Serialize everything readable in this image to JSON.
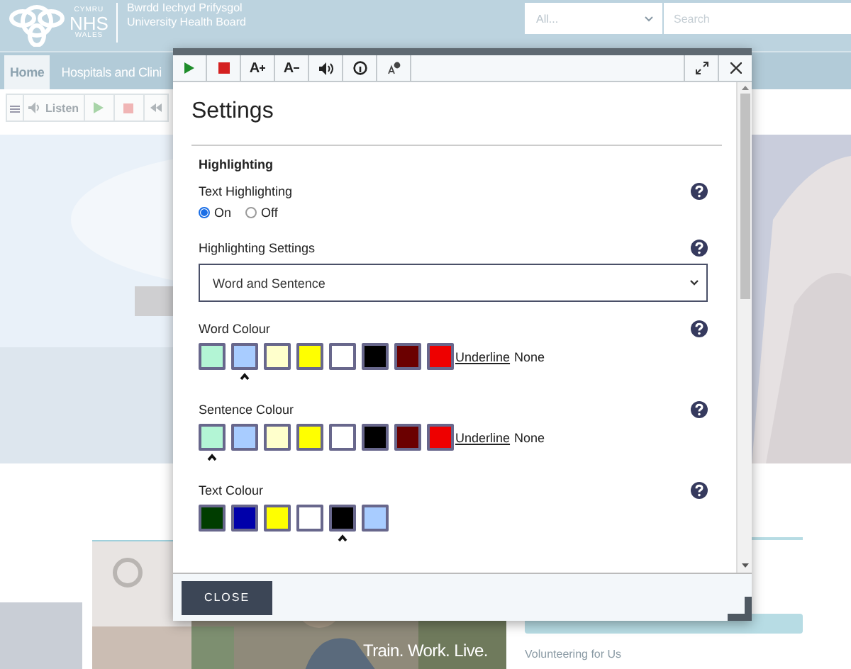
{
  "header": {
    "logo_lines": [
      "CYMRU",
      "NHS",
      "WALES"
    ],
    "org_lines": [
      "Bwrdd Iechyd Prifysgol",
      "University Health Board"
    ],
    "scope_select": {
      "value": "All..."
    },
    "search": {
      "placeholder": "Search"
    }
  },
  "nav": [
    {
      "label": "Home",
      "selected": true
    },
    {
      "label": "Hospitals and Clini",
      "selected": false
    }
  ],
  "listen_bar": {
    "label": "Listen"
  },
  "promo": {
    "caption": "Train. Work. Live."
  },
  "sidebar_link": "Volunteering for Us",
  "dialog": {
    "toolbar": [
      {
        "kind": "play"
      },
      {
        "kind": "stop"
      },
      {
        "kind": "font-larger",
        "glyph": "A"
      },
      {
        "kind": "font-smaller",
        "glyph": "A"
      },
      {
        "kind": "volume"
      },
      {
        "kind": "info"
      },
      {
        "kind": "settings"
      }
    ],
    "title": "Settings",
    "heading": "Highlighting",
    "text_highlighting": {
      "label": "Text Highlighting",
      "options": [
        {
          "label": "On",
          "selected": true
        },
        {
          "label": "Off",
          "selected": false
        }
      ]
    },
    "highlighting_settings": {
      "label": "Highlighting Settings",
      "value": "Word and Sentence"
    },
    "palettes": [
      {
        "label": "Word Colour",
        "underline_link": "Underline",
        "underline_value": "None",
        "swatches": [
          {
            "color": "#b3f5d5",
            "selected": false
          },
          {
            "color": "#a8ccff",
            "selected": true
          },
          {
            "color": "#ffffcc",
            "selected": false
          },
          {
            "color": "#ffff00",
            "selected": false
          },
          {
            "color": "#ffffff",
            "selected": false
          },
          {
            "color": "#000000",
            "selected": false
          },
          {
            "color": "#6b0000",
            "selected": false
          },
          {
            "color": "#ee0000",
            "selected": false
          }
        ]
      },
      {
        "label": "Sentence Colour",
        "underline_link": "Underline",
        "underline_value": "None",
        "swatches": [
          {
            "color": "#b3f5d5",
            "selected": true
          },
          {
            "color": "#a8ccff",
            "selected": false
          },
          {
            "color": "#ffffcc",
            "selected": false
          },
          {
            "color": "#ffff00",
            "selected": false
          },
          {
            "color": "#ffffff",
            "selected": false
          },
          {
            "color": "#000000",
            "selected": false
          },
          {
            "color": "#6b0000",
            "selected": false
          },
          {
            "color": "#ee0000",
            "selected": false
          }
        ]
      },
      {
        "label": "Text Colour",
        "swatches": [
          {
            "color": "#003d00",
            "selected": false
          },
          {
            "color": "#0000aa",
            "selected": false
          },
          {
            "color": "#ffff00",
            "selected": false
          },
          {
            "color": "#ffffff",
            "selected": false
          },
          {
            "color": "#000000",
            "selected": true
          },
          {
            "color": "#a8ccff",
            "selected": false
          }
        ]
      }
    ],
    "close_button": "CLOSE"
  }
}
